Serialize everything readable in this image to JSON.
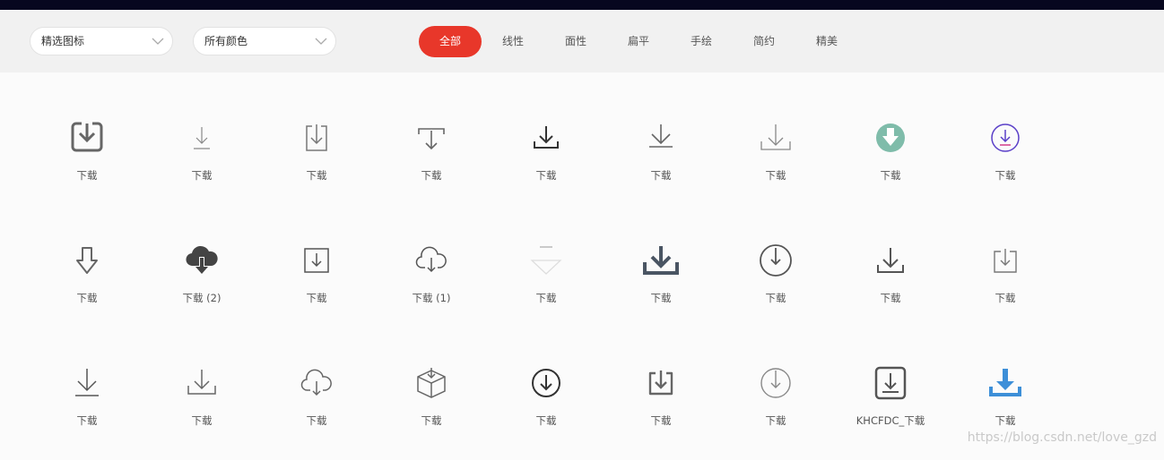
{
  "filters": {
    "set_select": "精选图标",
    "color_select": "所有颜色"
  },
  "tabs": [
    {
      "label": "全部",
      "active": true
    },
    {
      "label": "线性",
      "active": false
    },
    {
      "label": "面性",
      "active": false
    },
    {
      "label": "扁平",
      "active": false
    },
    {
      "label": "手绘",
      "active": false
    },
    {
      "label": "简约",
      "active": false
    },
    {
      "label": "精美",
      "active": false
    }
  ],
  "colors": {
    "accent": "#e8372a",
    "top_bar": "#07071f",
    "teal_icon": "#7fbcaa",
    "purple_icon": "#5a3fc8",
    "blue_icon": "#3d8fd8"
  },
  "icons": [
    {
      "label": "下载",
      "icon": "tray-download-bold-icon"
    },
    {
      "label": "下载",
      "icon": "thin-download-arrow-icon"
    },
    {
      "label": "下载",
      "icon": "box-download-icon"
    },
    {
      "label": "下载",
      "icon": "download-from-bar-icon"
    },
    {
      "label": "下载",
      "icon": "tray-download-icon"
    },
    {
      "label": "下载",
      "icon": "download-to-line-icon"
    },
    {
      "label": "下载",
      "icon": "tray-download-light-icon"
    },
    {
      "label": "下载",
      "icon": "teal-circle-download-icon"
    },
    {
      "label": "下载",
      "icon": "purple-circle-download-icon"
    },
    {
      "label": "下载",
      "icon": "outlined-arrow-down-icon"
    },
    {
      "label": "下载 (2)",
      "icon": "filled-cloud-download-icon"
    },
    {
      "label": "下载",
      "icon": "square-download-icon"
    },
    {
      "label": "下载 (1)",
      "icon": "cloud-download-icon"
    },
    {
      "label": "下载",
      "icon": "faint-triangle-download-icon"
    },
    {
      "label": "下载",
      "icon": "bold-tray-download-icon"
    },
    {
      "label": "下载",
      "icon": "circle-download-icon"
    },
    {
      "label": "下载",
      "icon": "tray-download-icon"
    },
    {
      "label": "下载",
      "icon": "box-arrow-in-icon"
    },
    {
      "label": "下载",
      "icon": "download-to-line-icon"
    },
    {
      "label": "下载",
      "icon": "tray-download-light-icon"
    },
    {
      "label": "下载",
      "icon": "cloud-download-icon"
    },
    {
      "label": "下载",
      "icon": "package-download-icon"
    },
    {
      "label": "下载",
      "icon": "circle-download-bold-icon"
    },
    {
      "label": "下载",
      "icon": "rounded-box-download-icon"
    },
    {
      "label": "下载",
      "icon": "circle-download-light-icon"
    },
    {
      "label": "KHCFDC_下载",
      "icon": "rounded-square-download-icon"
    },
    {
      "label": "下载",
      "icon": "blue-tray-download-icon"
    }
  ],
  "watermark": "https://blog.csdn.net/love_gzd"
}
